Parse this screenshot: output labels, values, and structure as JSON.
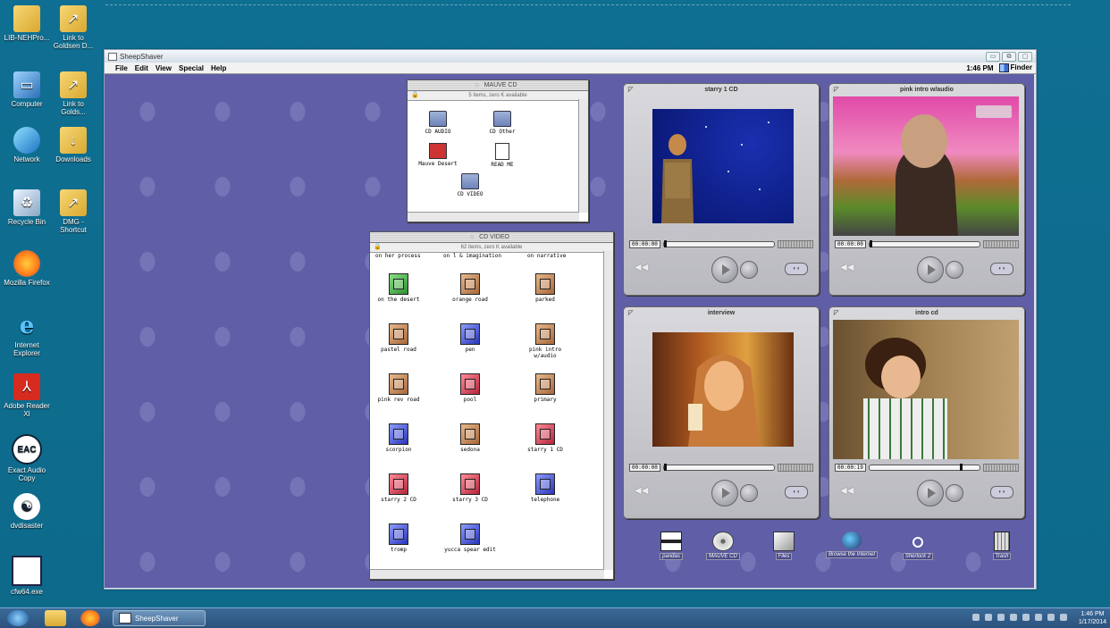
{
  "desktop": {
    "icons": [
      {
        "label": "LIB-NEHPro...",
        "icon": "folder-icon"
      },
      {
        "label": "Link to Goldsen D...",
        "icon": "folder-shortcut-icon"
      },
      {
        "label": "Computer",
        "icon": "computer-icon"
      },
      {
        "label": "Link to Golds...",
        "icon": "folder-shortcut-icon"
      },
      {
        "label": "Network",
        "icon": "network-icon"
      },
      {
        "label": "Downloads",
        "icon": "folder-icon"
      },
      {
        "label": "Recycle Bin",
        "icon": "recycle-bin-icon"
      },
      {
        "label": "DMG - Shortcut",
        "icon": "folder-shortcut-icon"
      },
      {
        "label": "Mozilla Firefox",
        "icon": "firefox-icon"
      },
      {
        "label": "Internet Explorer",
        "icon": "ie-icon"
      },
      {
        "label": "Adobe Reader XI",
        "icon": "pdf-icon"
      },
      {
        "label": "Exact Audio Copy",
        "icon": "eac-icon"
      },
      {
        "label": "dvdisaster",
        "icon": "dvdisaster-icon"
      },
      {
        "label": "cfw64.exe",
        "icon": "exe-icon"
      }
    ]
  },
  "sheepshaver": {
    "title": "SheepShaver",
    "controls": [
      "▭",
      "⧉",
      "▢"
    ],
    "menubar": {
      "items": [
        "File",
        "Edit",
        "View",
        "Special",
        "Help"
      ],
      "time": "1:46 PM",
      "app": "Finder"
    },
    "mauve_cd": {
      "title": "MAUVE CD",
      "info": "5 items, zero K available",
      "items": [
        "CD AUDIO",
        "CD Other",
        "Mauve Desert",
        "READ ME",
        "CD VIDEO"
      ]
    },
    "cd_video": {
      "title": "CD VIDEO",
      "info": "62 items, zero K available",
      "headers": [
        "on her process",
        "on l & imagination",
        "on narrative"
      ],
      "items": [
        "on the desert",
        "orange road",
        "parked",
        "pastel road",
        "pen",
        "pink intro w/audio",
        "pink rev road",
        "pool",
        "primary",
        "scorpion",
        "sedona",
        "starry 1 CD",
        "starry 2 CD",
        "starry 3 CD",
        "telephone",
        "tromp",
        "yucca spear edit"
      ]
    },
    "players": [
      {
        "title": "starry 1 CD",
        "timecode": "00:00:00",
        "progress": 0
      },
      {
        "title": "pink intro w/audio",
        "timecode": "00:00:00",
        "progress": 0
      },
      {
        "title": "interview",
        "timecode": "00:00:00",
        "progress": 0
      },
      {
        "title": "intro cd",
        "timecode": "00:00:19",
        "progress": 0.82
      }
    ],
    "desktop_icons": [
      "pandas",
      "MAUVE CD",
      "Files",
      "Browse the Internet",
      "Sherlock 2",
      "Trash"
    ]
  },
  "taskbar": {
    "active_app": "SheepShaver",
    "time": "1:46 PM",
    "date": "1/17/2014"
  }
}
